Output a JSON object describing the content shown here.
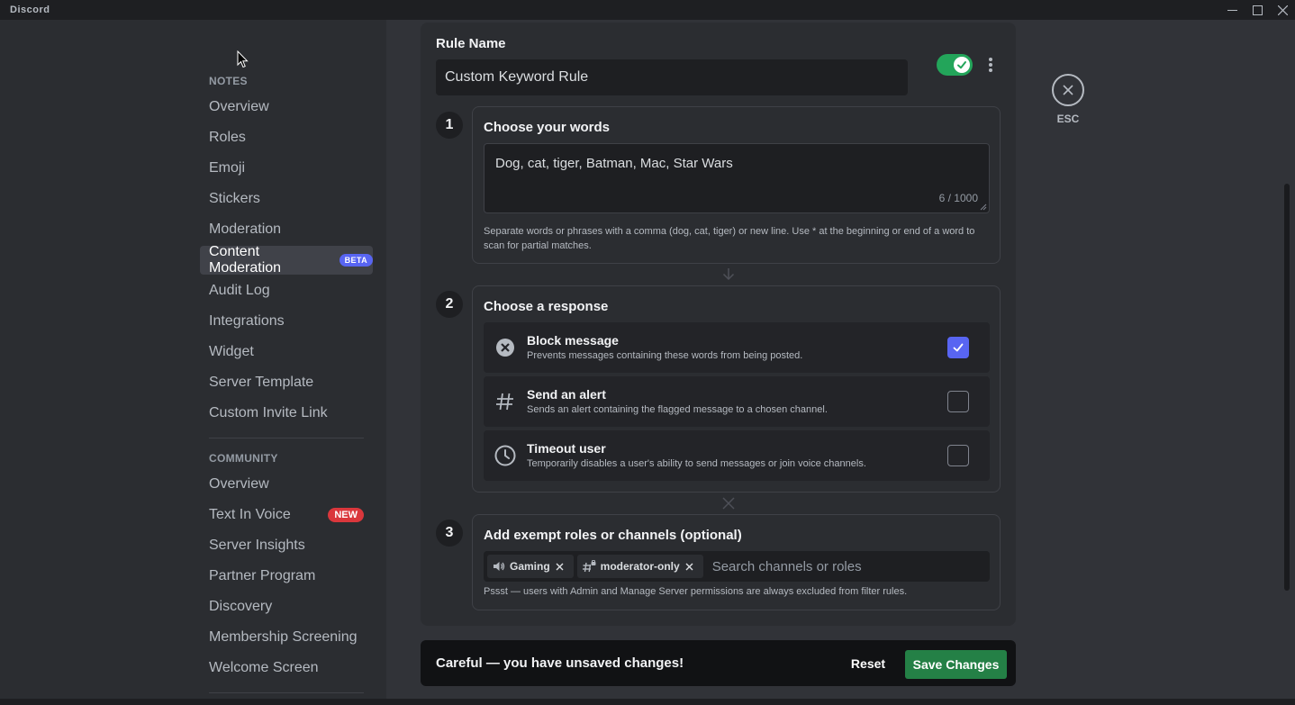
{
  "app": {
    "title": "Discord"
  },
  "window_controls": {
    "minimize_icon": "minimize-icon",
    "maximize_icon": "maximize-icon",
    "close_icon": "close-icon"
  },
  "sidebar": {
    "notes_header": "NOTES",
    "notes_items": [
      {
        "label": "Overview"
      },
      {
        "label": "Roles"
      },
      {
        "label": "Emoji"
      },
      {
        "label": "Stickers"
      },
      {
        "label": "Moderation"
      },
      {
        "label": "Content Moderation",
        "badge": "BETA",
        "selected": true
      },
      {
        "label": "Audit Log"
      },
      {
        "label": "Integrations"
      },
      {
        "label": "Widget"
      },
      {
        "label": "Server Template"
      },
      {
        "label": "Custom Invite Link"
      }
    ],
    "community_header": "COMMUNITY",
    "community_items": [
      {
        "label": "Overview"
      },
      {
        "label": "Text In Voice",
        "badge": "NEW"
      },
      {
        "label": "Server Insights"
      },
      {
        "label": "Partner Program"
      },
      {
        "label": "Discovery"
      },
      {
        "label": "Membership Screening"
      },
      {
        "label": "Welcome Screen"
      }
    ]
  },
  "rule": {
    "name_label": "Rule Name",
    "name_value": "Custom Keyword Rule",
    "enabled": true
  },
  "step1": {
    "number": "1",
    "title": "Choose your words",
    "words": "Dog, cat, tiger, Batman, Mac, Star Wars",
    "count": "6 / 1000",
    "help": "Separate words or phrases with a comma (dog, cat, tiger) or new line. Use * at the beginning or end of a word to scan for partial matches."
  },
  "step2": {
    "number": "2",
    "title": "Choose a response",
    "responses": [
      {
        "title": "Block message",
        "desc": "Prevents messages containing these words from being posted.",
        "checked": true,
        "icon": "block-icon"
      },
      {
        "title": "Send an alert",
        "desc": "Sends an alert containing the flagged message to a chosen channel.",
        "checked": false,
        "icon": "hashtag-icon"
      },
      {
        "title": "Timeout user",
        "desc": "Temporarily disables a user's ability to send messages or join voice channels.",
        "checked": false,
        "icon": "clock-icon"
      }
    ]
  },
  "step3": {
    "number": "3",
    "title": "Add exempt roles or channels (optional)",
    "chips": [
      {
        "label": "Gaming",
        "icon": "speaker-icon"
      },
      {
        "label": "moderator-only",
        "icon": "locked-hashtag-icon"
      }
    ],
    "search_placeholder": "Search channels or roles",
    "note": "Pssst — users with Admin and Manage Server permissions are always excluded from filter rules."
  },
  "notice": {
    "text": "Careful — you have unsaved changes!",
    "reset_label": "Reset",
    "save_label": "Save Changes"
  },
  "esc": {
    "label": "ESC"
  },
  "colors": {
    "accent": "#5865f2",
    "toggle_on": "#23a55a",
    "save": "#248046",
    "new_badge": "#da373c"
  }
}
